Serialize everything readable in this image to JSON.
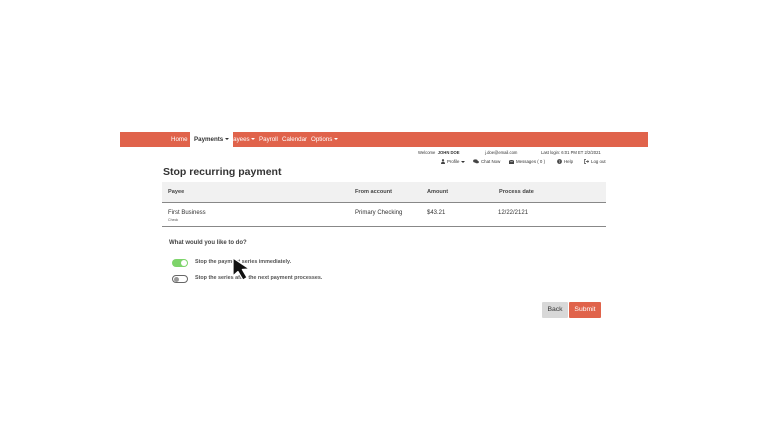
{
  "nav": {
    "items": [
      {
        "label": "Home"
      },
      {
        "label": "Payments"
      },
      {
        "label": "Payees"
      },
      {
        "label": "Payroll"
      },
      {
        "label": "Calendar"
      },
      {
        "label": "Options"
      }
    ]
  },
  "user": {
    "welcome_prefix": "Welcome",
    "name": "JOHN DOE",
    "email": "j.doe@email.com",
    "last_login": "Last login: 6:01 PM ET  2/2/2021"
  },
  "toolbar": {
    "profile": "Profile",
    "chat": "Chat Now",
    "messages": "Messages ( 0 )",
    "help": "Help",
    "logout": "Log out"
  },
  "page": {
    "title": "Stop recurring payment"
  },
  "table": {
    "headers": [
      "Payee",
      "From account",
      "Amount",
      "Process date"
    ],
    "row": {
      "payee": "First Business",
      "payee_sub": "Check",
      "account": "Primary Checking",
      "amount": "$43.21",
      "date": "12/22/2121"
    }
  },
  "options": {
    "question": "What would you like to do?",
    "choices": [
      {
        "label": "Stop the payment series immediately.",
        "selected": true
      },
      {
        "label": "Stop the series after the next payment processes.",
        "selected": false
      }
    ]
  },
  "buttons": {
    "back": "Back",
    "submit": "Submit"
  },
  "colors": {
    "accent": "#e0634b",
    "toggle_on": "#7ed46b"
  }
}
